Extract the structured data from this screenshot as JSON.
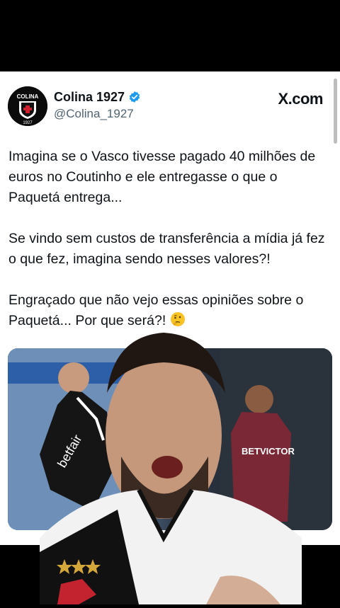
{
  "tweet": {
    "display_name": "Colina 1927",
    "handle": "@Colina_1927",
    "site": "X.com",
    "avatar_text": "COLINA",
    "avatar_year": "1927",
    "verified_icon": "verified-badge-icon",
    "paragraphs": [
      "Imagina se o Vasco tivesse pagado 40 milhões de euros no Coutinho e ele entregasse o que o Paquetá entrega...",
      "Se vindo sem custos de transferência a mídia já fez o que fez, imagina sendo nesses valores?!",
      "Engraçado que não vejo essas opiniões sobre o Paquetá... Por que será?!"
    ],
    "emoji": "thinking-face"
  },
  "media": {
    "left_shirt_text": "betfair",
    "right_shirt_text": "BETVICTOR"
  },
  "colors": {
    "background": "#000000",
    "card": "#ffffff",
    "verified": "#1d9bf0",
    "text": "#0f1419",
    "muted": "#536471"
  }
}
